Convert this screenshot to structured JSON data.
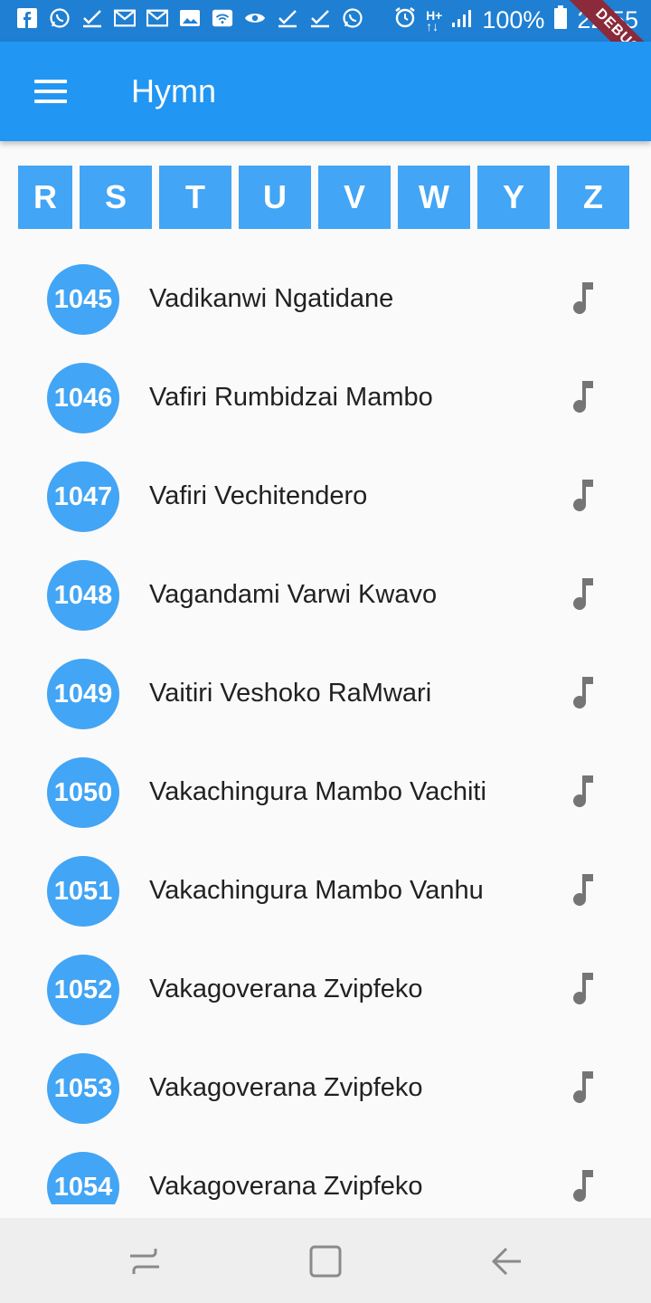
{
  "status_bar": {
    "battery": "100%",
    "time": "22:55",
    "debug_label": "DEBUG",
    "icons": [
      "facebook-icon",
      "whatsapp-icon",
      "check-icon",
      "gmail-icon",
      "gmail-icon",
      "image-icon",
      "wifi-icon",
      "eye-icon",
      "check-icon",
      "check-icon",
      "whatsapp-icon"
    ]
  },
  "app_bar": {
    "title": "Hymn",
    "menu_icon": "hamburger-menu-icon"
  },
  "letters": [
    "R",
    "S",
    "T",
    "U",
    "V",
    "W",
    "Y",
    "Z"
  ],
  "hymns": [
    {
      "number": "1045",
      "title": "Vadikanwi Ngatidane"
    },
    {
      "number": "1046",
      "title": "Vafiri Rumbidzai Mambo"
    },
    {
      "number": "1047",
      "title": "Vafiri Vechitendero"
    },
    {
      "number": "1048",
      "title": "Vagandami Varwi Kwavo"
    },
    {
      "number": "1049",
      "title": "Vaitiri Veshoko RaMwari"
    },
    {
      "number": "1050",
      "title": "Vakachingura Mambo Vachiti"
    },
    {
      "number": "1051",
      "title": "Vakachingura Mambo Vanhu"
    },
    {
      "number": "1052",
      "title": "Vakagoverana Zvipfeko"
    },
    {
      "number": "1053",
      "title": "Vakagoverana Zvipfeko"
    },
    {
      "number": "1054",
      "title": "Vakagoverana Zvipfeko"
    }
  ],
  "colors": {
    "primary": "#2196f3",
    "accent": "#42a5f5",
    "statusbar": "#1f7fd2"
  }
}
